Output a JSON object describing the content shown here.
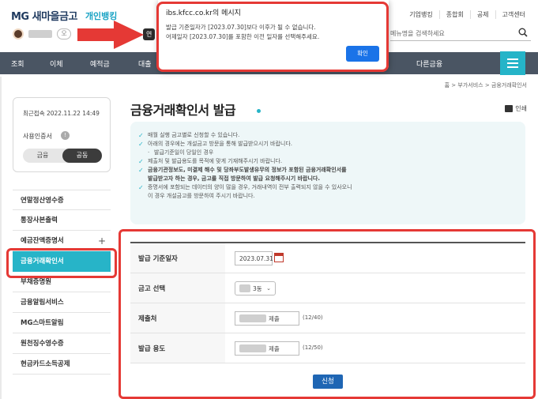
{
  "header": {
    "logo": "MG 새마을금고",
    "logo_sub": "개인뱅킹",
    "user_pill": "오",
    "dark_pill": "연",
    "top_links": [
      "기업뱅킹",
      "종합회",
      "공제",
      "고객센터"
    ],
    "search_placeholder": "메뉴명을 검색하세요"
  },
  "nav": {
    "items": [
      "조회",
      "이체",
      "예적금",
      "대출",
      "다른금융"
    ]
  },
  "breadcrumb": "홈 > 부가서비스 > 금융거래확인서",
  "sidebar": {
    "last_login": "최근접속  2022.11.22 14:49",
    "cert_label": "사용인증서",
    "info_mark": "!",
    "toggle_a": "금융",
    "toggle_b": "공동",
    "menu": [
      "연말정산영수증",
      "통장사본출력",
      "예금잔액증명서",
      "금융거래확인서",
      "부채증명원",
      "금융알림서비스",
      "MG스마트알림",
      "원천징수영수증",
      "현금카드소득공제"
    ],
    "plus": "+"
  },
  "main": {
    "title": "금융거래확인서 발급",
    "print_label": "인쇄",
    "notice": [
      "매월 실행 금고별로 신청할 수 있습니다.",
      "아래의 경우에는 개설금고 방문을 통해 발급받으시기 바랍니다.",
      "발급기준일이 당일인 경우",
      "제출처 및 발급용도를 목적에 맞게 기재해주시기 바랍니다.",
      "금융기관정보도, 미결제 해수 및 당좌부도발생유무의 정보가 포함된 금융거래확인서를",
      "발급받고자 하는 경우, 금고를 직접 방문하여 발급 요청해주시기 바랍니다.",
      "증명서에 포함되는 데이터의 양이 많을 경우, 거래내역이 전부 출력되지 않을 수 있사오니",
      "이 경우 개설금고를 방문하여 주시기 바랍니다."
    ],
    "form": {
      "date_label": "발급 기준일자",
      "date_value": "2023.07.31",
      "bank_label": "금고 선택",
      "bank_value": "3동",
      "recipient_label": "제출처",
      "recipient_value": "제출",
      "recipient_count": "(12/40)",
      "purpose_label": "발급 용도",
      "purpose_value": "제출",
      "purpose_count": "(12/50)"
    },
    "submit": "신청"
  },
  "dialog": {
    "title": "ibs.kfcc.co.kr의 메시지",
    "line1": "발급 기준일자가 [2023.07.30]보다 이후가 될 수 없습니다.",
    "line2": "어제일자 [2023.07.30]를 포함한 이전 일자를 선택해주세요.",
    "ok": "확인"
  },
  "colors": {
    "accent": "#27b4c8",
    "nav_bg": "#4a5563",
    "highlight": "#e53935",
    "button_blue": "#1f66b4"
  }
}
